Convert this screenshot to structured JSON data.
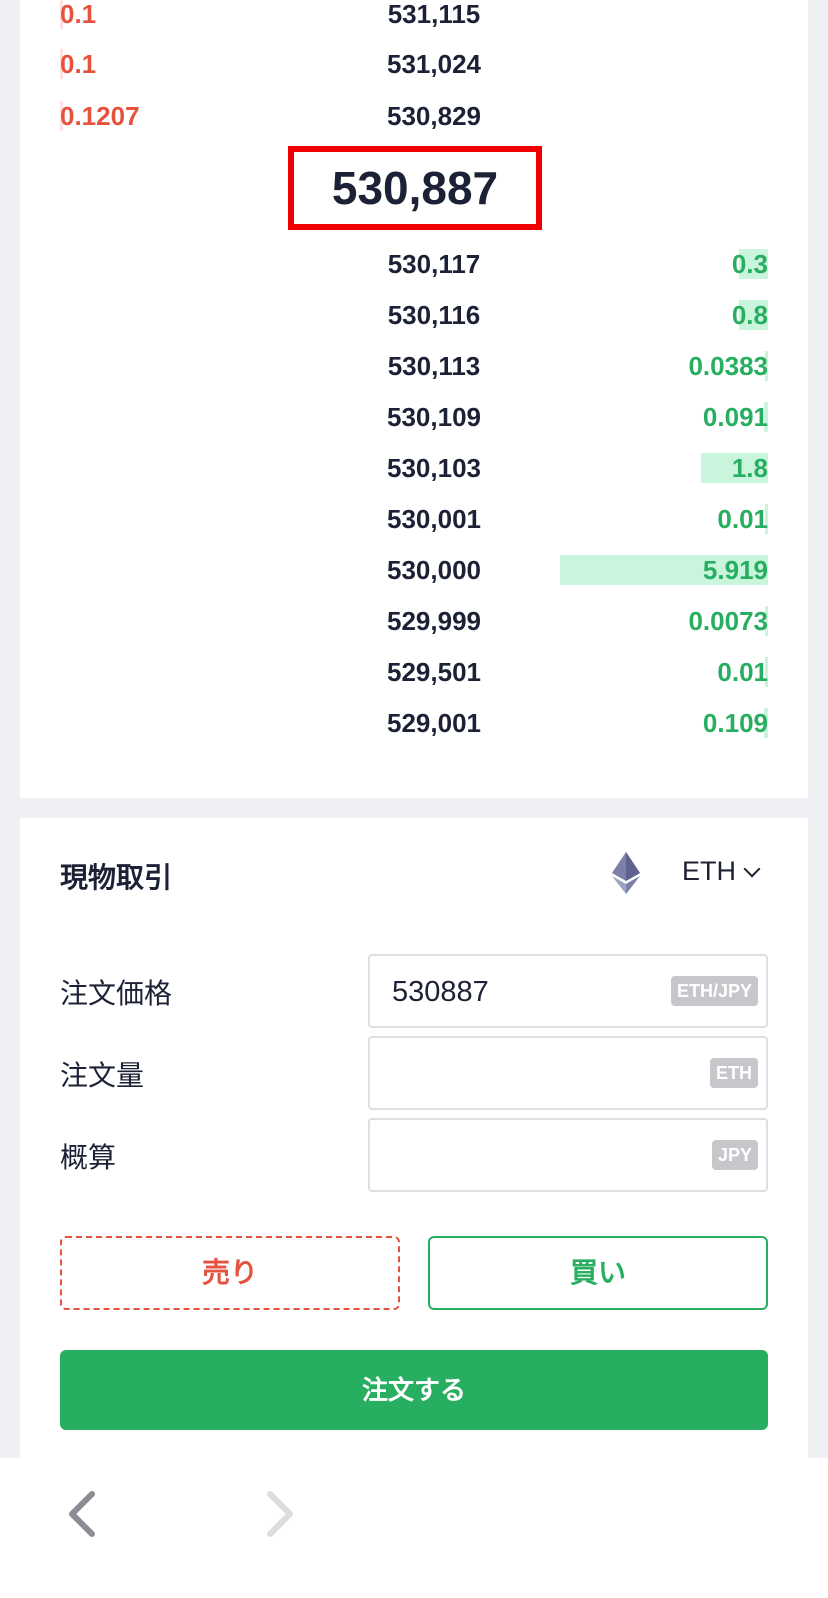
{
  "order_book": {
    "asks": [
      {
        "size": "0.1",
        "price": "531,115",
        "depth": 0.01
      },
      {
        "size": "0.1",
        "price": "531,024",
        "depth": 0.01
      },
      {
        "size": "0.1207",
        "price": "530,829",
        "depth": 0.01
      }
    ],
    "last_price": "530,887",
    "bids": [
      {
        "price": "530,117",
        "size": "0.3",
        "depth": 0.14
      },
      {
        "price": "530,116",
        "size": "0.8",
        "depth": 0.14
      },
      {
        "price": "530,113",
        "size": "0.0383",
        "depth": 0.01
      },
      {
        "price": "530,109",
        "size": "0.091",
        "depth": 0.02
      },
      {
        "price": "530,103",
        "size": "1.8",
        "depth": 0.32
      },
      {
        "price": "530,001",
        "size": "0.01",
        "depth": 0.0
      },
      {
        "price": "530,000",
        "size": "5.919",
        "depth": 1.0
      },
      {
        "price": "529,999",
        "size": "0.0073",
        "depth": 0.0
      },
      {
        "price": "529,501",
        "size": "0.01",
        "depth": 0.0
      },
      {
        "price": "529,001",
        "size": "0.109",
        "depth": 0.02
      }
    ]
  },
  "trade_panel": {
    "title": "現物取引",
    "symbol": "ETH",
    "price_label": "注文価格",
    "price_value": "530887",
    "price_unit": "ETH/JPY",
    "amount_label": "注文量",
    "amount_value": "",
    "amount_unit": "ETH",
    "estimate_label": "概算",
    "estimate_value": "",
    "estimate_unit": "JPY",
    "sell_label": "売り",
    "buy_label": "買い",
    "submit_label": "注文する"
  },
  "colors": {
    "ask": "#e5533f",
    "bid": "#27ae60",
    "highlight_box": "#f00000"
  },
  "icons": {
    "symbol_logo": "ethereum-icon",
    "back": "chevron-left-icon",
    "forward": "chevron-right-icon"
  }
}
